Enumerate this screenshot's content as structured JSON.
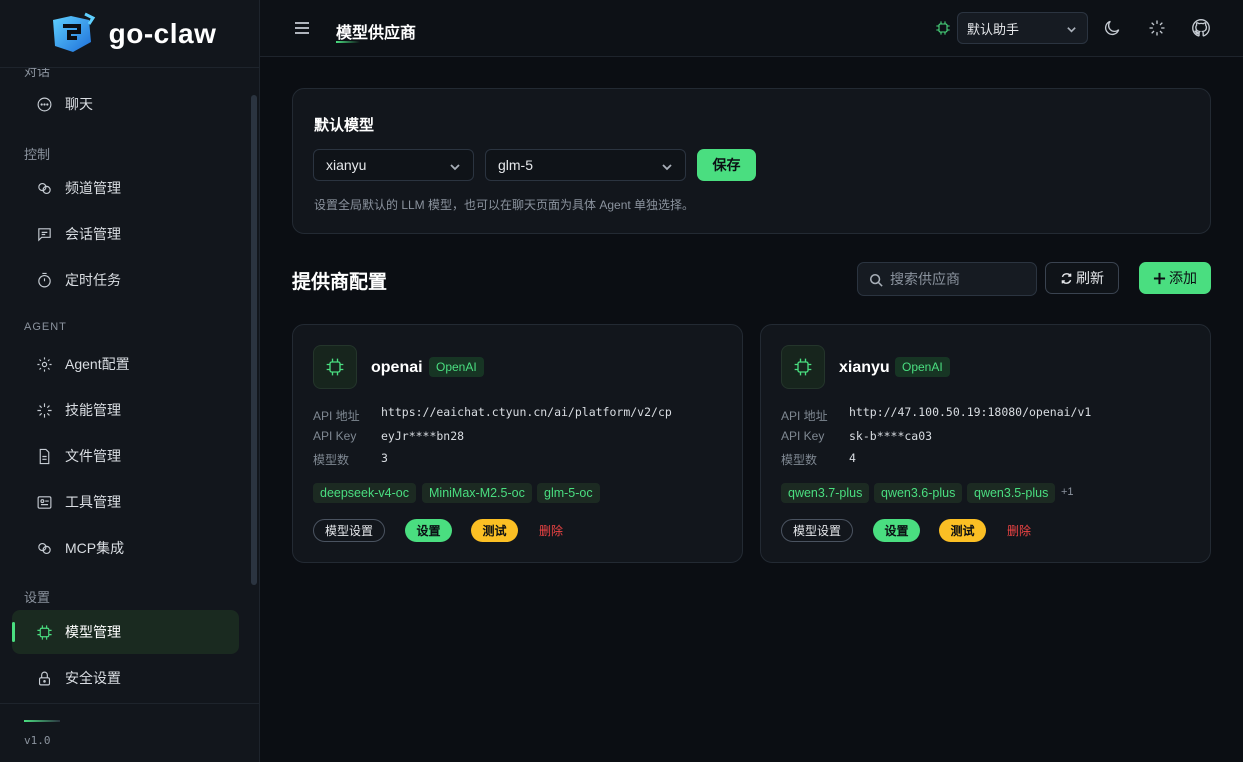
{
  "app": {
    "logo_text": "go-claw",
    "version": "v1.0"
  },
  "sidebar": {
    "sections": [
      {
        "label": "对话"
      },
      {
        "label": "控制"
      },
      {
        "label": "AGENT"
      },
      {
        "label": "设置"
      }
    ],
    "items": [
      {
        "label": "聊天",
        "icon": "chat-icon"
      },
      {
        "label": "频道管理",
        "icon": "link-icon"
      },
      {
        "label": "会话管理",
        "icon": "message-icon"
      },
      {
        "label": "定时任务",
        "icon": "timer-icon"
      },
      {
        "label": "Agent配置",
        "icon": "gear-icon"
      },
      {
        "label": "技能管理",
        "icon": "sparkle-icon"
      },
      {
        "label": "文件管理",
        "icon": "file-icon"
      },
      {
        "label": "工具管理",
        "icon": "toolbox-icon"
      },
      {
        "label": "MCP集成",
        "icon": "link-icon"
      },
      {
        "label": "模型管理",
        "icon": "chip-icon",
        "active": true
      },
      {
        "label": "安全设置",
        "icon": "lock-icon"
      }
    ]
  },
  "header": {
    "title": "模型供应商",
    "agent_select": "默认助手"
  },
  "default_model": {
    "title": "默认模型",
    "provider": "xianyu",
    "model": "glm-5",
    "save_label": "保存",
    "hint": "设置全局默认的 LLM 模型，也可以在聊天页面为具体 Agent 单独选择。"
  },
  "providers_section": {
    "title": "提供商配置",
    "search_placeholder": "搜索供应商",
    "refresh_label": "刷新",
    "add_label": "添加"
  },
  "providers": [
    {
      "name": "openai",
      "type": "OpenAI",
      "api_url_label": "API 地址",
      "api_url": "https://eaichat.ctyun.cn/ai/platform/v2/cp",
      "api_key_label": "API Key",
      "api_key": "eyJr****bn28",
      "model_count_label": "模型数",
      "model_count": "3",
      "models": [
        "deepseek-v4-oc",
        "MiniMax-M2.5-oc",
        "glm-5-oc"
      ],
      "more": "",
      "actions": {
        "model_settings": "模型设置",
        "settings": "设置",
        "test": "测试",
        "delete": "删除"
      }
    },
    {
      "name": "xianyu",
      "type": "OpenAI",
      "api_url_label": "API 地址",
      "api_url": "http://47.100.50.19:18080/openai/v1",
      "api_key_label": "API Key",
      "api_key": "sk-b****ca03",
      "model_count_label": "模型数",
      "model_count": "4",
      "models": [
        "qwen3.7-plus",
        "qwen3.6-plus",
        "qwen3.5-plus"
      ],
      "more": "+1",
      "actions": {
        "model_settings": "模型设置",
        "settings": "设置",
        "test": "测试",
        "delete": "删除"
      }
    }
  ],
  "colors": {
    "accent": "#4ade80",
    "warning": "#fbbf24",
    "danger": "#ef4444",
    "background": "#0b0e13",
    "panel": "#12161c"
  }
}
